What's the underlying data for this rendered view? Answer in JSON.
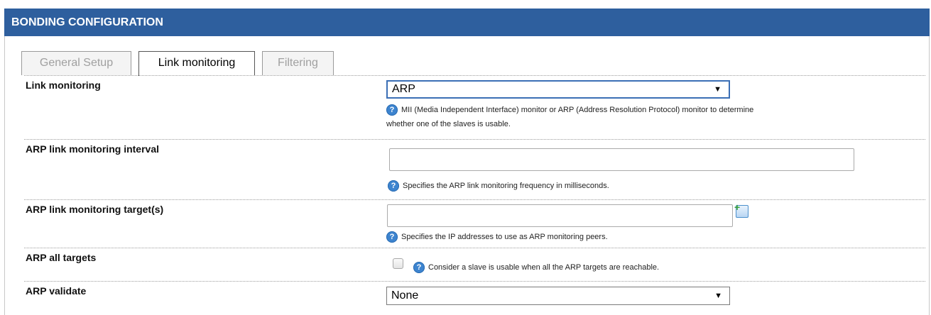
{
  "header": {
    "title": "BONDING CONFIGURATION"
  },
  "tabs": [
    {
      "label": "General Setup",
      "active": false
    },
    {
      "label": "Link monitoring",
      "active": true
    },
    {
      "label": "Filtering",
      "active": false
    }
  ],
  "fields": {
    "link_monitoring": {
      "label": "Link monitoring",
      "value": "ARP",
      "help_line1": "MII (Media Independent Interface) monitor or ARP (Address Resolution Protocol) monitor to determine",
      "help_line2": "whether one of the slaves is usable."
    },
    "arp_interval": {
      "label": "ARP link monitoring interval",
      "value": "",
      "help": "Specifies the ARP link monitoring frequency in milliseconds."
    },
    "arp_targets": {
      "label": "ARP link monitoring target(s)",
      "value": "",
      "help": "Specifies the IP addresses to use as ARP monitoring peers."
    },
    "arp_all_targets": {
      "label": "ARP all targets",
      "checked": false,
      "help": "Consider a slave is usable when all the ARP targets are reachable."
    },
    "arp_validate": {
      "label": "ARP validate",
      "value": "None"
    }
  },
  "icons": {
    "help": "help-question-icon",
    "add": "add-item-icon",
    "arrow": "dropdown-arrow-icon"
  },
  "colors": {
    "header_bg": "#2e5f9e",
    "help_icon": "#3d84cf",
    "focus_border": "#3b6fb5"
  }
}
